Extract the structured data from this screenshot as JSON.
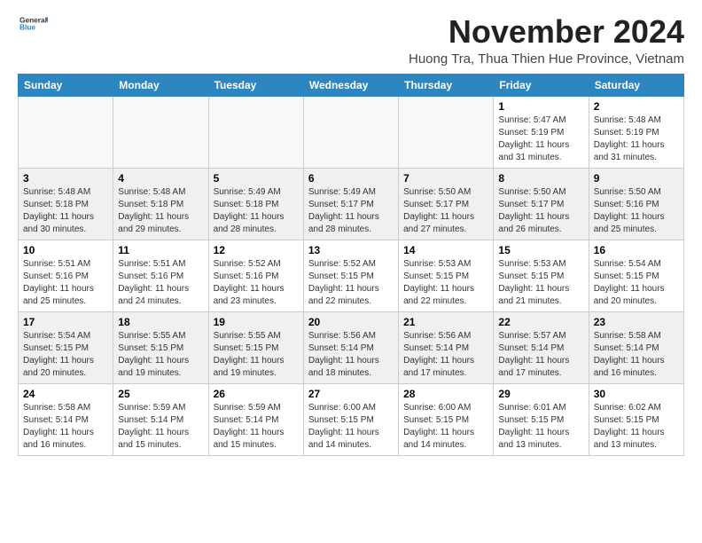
{
  "logo": {
    "general": "General",
    "blue": "Blue"
  },
  "title": "November 2024",
  "location": "Huong Tra, Thua Thien Hue Province, Vietnam",
  "weekdays": [
    "Sunday",
    "Monday",
    "Tuesday",
    "Wednesday",
    "Thursday",
    "Friday",
    "Saturday"
  ],
  "weeks": [
    [
      {
        "day": "",
        "info": ""
      },
      {
        "day": "",
        "info": ""
      },
      {
        "day": "",
        "info": ""
      },
      {
        "day": "",
        "info": ""
      },
      {
        "day": "",
        "info": ""
      },
      {
        "day": "1",
        "info": "Sunrise: 5:47 AM\nSunset: 5:19 PM\nDaylight: 11 hours\nand 31 minutes."
      },
      {
        "day": "2",
        "info": "Sunrise: 5:48 AM\nSunset: 5:19 PM\nDaylight: 11 hours\nand 31 minutes."
      }
    ],
    [
      {
        "day": "3",
        "info": "Sunrise: 5:48 AM\nSunset: 5:18 PM\nDaylight: 11 hours\nand 30 minutes."
      },
      {
        "day": "4",
        "info": "Sunrise: 5:48 AM\nSunset: 5:18 PM\nDaylight: 11 hours\nand 29 minutes."
      },
      {
        "day": "5",
        "info": "Sunrise: 5:49 AM\nSunset: 5:18 PM\nDaylight: 11 hours\nand 28 minutes."
      },
      {
        "day": "6",
        "info": "Sunrise: 5:49 AM\nSunset: 5:17 PM\nDaylight: 11 hours\nand 28 minutes."
      },
      {
        "day": "7",
        "info": "Sunrise: 5:50 AM\nSunset: 5:17 PM\nDaylight: 11 hours\nand 27 minutes."
      },
      {
        "day": "8",
        "info": "Sunrise: 5:50 AM\nSunset: 5:17 PM\nDaylight: 11 hours\nand 26 minutes."
      },
      {
        "day": "9",
        "info": "Sunrise: 5:50 AM\nSunset: 5:16 PM\nDaylight: 11 hours\nand 25 minutes."
      }
    ],
    [
      {
        "day": "10",
        "info": "Sunrise: 5:51 AM\nSunset: 5:16 PM\nDaylight: 11 hours\nand 25 minutes."
      },
      {
        "day": "11",
        "info": "Sunrise: 5:51 AM\nSunset: 5:16 PM\nDaylight: 11 hours\nand 24 minutes."
      },
      {
        "day": "12",
        "info": "Sunrise: 5:52 AM\nSunset: 5:16 PM\nDaylight: 11 hours\nand 23 minutes."
      },
      {
        "day": "13",
        "info": "Sunrise: 5:52 AM\nSunset: 5:15 PM\nDaylight: 11 hours\nand 22 minutes."
      },
      {
        "day": "14",
        "info": "Sunrise: 5:53 AM\nSunset: 5:15 PM\nDaylight: 11 hours\nand 22 minutes."
      },
      {
        "day": "15",
        "info": "Sunrise: 5:53 AM\nSunset: 5:15 PM\nDaylight: 11 hours\nand 21 minutes."
      },
      {
        "day": "16",
        "info": "Sunrise: 5:54 AM\nSunset: 5:15 PM\nDaylight: 11 hours\nand 20 minutes."
      }
    ],
    [
      {
        "day": "17",
        "info": "Sunrise: 5:54 AM\nSunset: 5:15 PM\nDaylight: 11 hours\nand 20 minutes."
      },
      {
        "day": "18",
        "info": "Sunrise: 5:55 AM\nSunset: 5:15 PM\nDaylight: 11 hours\nand 19 minutes."
      },
      {
        "day": "19",
        "info": "Sunrise: 5:55 AM\nSunset: 5:15 PM\nDaylight: 11 hours\nand 19 minutes."
      },
      {
        "day": "20",
        "info": "Sunrise: 5:56 AM\nSunset: 5:14 PM\nDaylight: 11 hours\nand 18 minutes."
      },
      {
        "day": "21",
        "info": "Sunrise: 5:56 AM\nSunset: 5:14 PM\nDaylight: 11 hours\nand 17 minutes."
      },
      {
        "day": "22",
        "info": "Sunrise: 5:57 AM\nSunset: 5:14 PM\nDaylight: 11 hours\nand 17 minutes."
      },
      {
        "day": "23",
        "info": "Sunrise: 5:58 AM\nSunset: 5:14 PM\nDaylight: 11 hours\nand 16 minutes."
      }
    ],
    [
      {
        "day": "24",
        "info": "Sunrise: 5:58 AM\nSunset: 5:14 PM\nDaylight: 11 hours\nand 16 minutes."
      },
      {
        "day": "25",
        "info": "Sunrise: 5:59 AM\nSunset: 5:14 PM\nDaylight: 11 hours\nand 15 minutes."
      },
      {
        "day": "26",
        "info": "Sunrise: 5:59 AM\nSunset: 5:14 PM\nDaylight: 11 hours\nand 15 minutes."
      },
      {
        "day": "27",
        "info": "Sunrise: 6:00 AM\nSunset: 5:15 PM\nDaylight: 11 hours\nand 14 minutes."
      },
      {
        "day": "28",
        "info": "Sunrise: 6:00 AM\nSunset: 5:15 PM\nDaylight: 11 hours\nand 14 minutes."
      },
      {
        "day": "29",
        "info": "Sunrise: 6:01 AM\nSunset: 5:15 PM\nDaylight: 11 hours\nand 13 minutes."
      },
      {
        "day": "30",
        "info": "Sunrise: 6:02 AM\nSunset: 5:15 PM\nDaylight: 11 hours\nand 13 minutes."
      }
    ]
  ]
}
